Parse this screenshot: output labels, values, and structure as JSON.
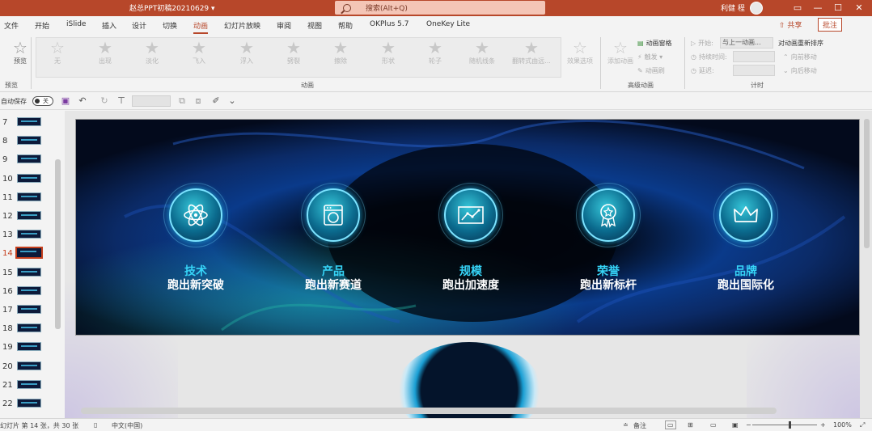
{
  "titlebar": {
    "doc_title": "赵总PPT初稿20210629 ▾",
    "search_placeholder": "搜索(Alt+Q)",
    "user": "利健 程",
    "minimize": "—",
    "maximize": "☐",
    "close": "✕"
  },
  "menu": {
    "tabs": [
      "文件",
      "开始",
      "iSlide",
      "插入",
      "设计",
      "切换",
      "动画",
      "幻灯片放映",
      "审阅",
      "视图",
      "帮助",
      "OKPlus 5.7",
      "OneKey Lite"
    ],
    "active_tab": "动画",
    "share": "共享",
    "comment": "批注"
  },
  "ribbon": {
    "preview": {
      "label": "预览",
      "group": "预览"
    },
    "effects": [
      "无",
      "出现",
      "淡化",
      "飞入",
      "浮入",
      "劈裂",
      "擦除",
      "形状",
      "轮子",
      "随机线条",
      "翻转式由远..."
    ],
    "effect_options": "效果选项",
    "animation_group": "动画",
    "add_animation": "添加动画",
    "animation_pane": "动画窗格",
    "trigger": "触发 ▾",
    "painter": "动画刷",
    "advanced_group": "高级动画",
    "start_label": "开始:",
    "start_value": "与上一动画...",
    "duration_label": "持续时间:",
    "delay_label": "延迟:",
    "reorder_title": "对动画重新排序",
    "move_earlier": "向前移动",
    "move_later": "向后移动",
    "timing_group": "计时"
  },
  "qat": {
    "autosave": "自动保存",
    "toggle": "关"
  },
  "thumbnails": [
    {
      "num": "7"
    },
    {
      "num": "8"
    },
    {
      "num": "9"
    },
    {
      "num": "10"
    },
    {
      "num": "11"
    },
    {
      "num": "12"
    },
    {
      "num": "13"
    },
    {
      "num": "14",
      "active": true
    },
    {
      "num": "15"
    },
    {
      "num": "16"
    },
    {
      "num": "17"
    },
    {
      "num": "18"
    },
    {
      "num": "19"
    },
    {
      "num": "20"
    },
    {
      "num": "21"
    },
    {
      "num": "22"
    }
  ],
  "slide": {
    "features": [
      {
        "icon": "atom-icon",
        "title": "技术",
        "subtitle": "跑出新突破"
      },
      {
        "icon": "washing-machine-icon",
        "title": "产品",
        "subtitle": "跑出新赛道"
      },
      {
        "icon": "growth-chart-icon",
        "title": "规模",
        "subtitle": "跑出加速度"
      },
      {
        "icon": "medal-icon",
        "title": "荣誉",
        "subtitle": "跑出新标杆"
      },
      {
        "icon": "crown-icon",
        "title": "品牌",
        "subtitle": "跑出国际化"
      }
    ]
  },
  "status": {
    "slide_info": "幻灯片 第 14 张，共 30 张",
    "language": "中文(中国)",
    "notes": "备注",
    "zoom": "100%"
  },
  "colors": {
    "accent": "#b7472a",
    "feature_title": "#36d4f7",
    "slide_bg": "#020714"
  }
}
